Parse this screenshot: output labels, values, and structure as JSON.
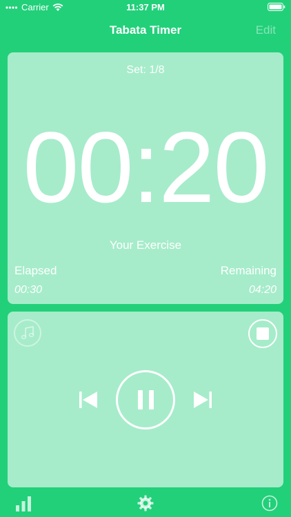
{
  "status_bar": {
    "carrier": "Carrier",
    "time": "11:37 PM"
  },
  "nav": {
    "title": "Tabata Timer",
    "edit_label": "Edit"
  },
  "timer": {
    "set_label": "Set: 1/8",
    "clock": "00:20",
    "exercise": "Your Exercise",
    "elapsed_label": "Elapsed",
    "elapsed_value": "00:30",
    "remaining_label": "Remaining",
    "remaining_value": "04:20"
  },
  "colors": {
    "background": "#22d07a",
    "card": "rgba(255,255,255,0.6)",
    "foreground": "#ffffff"
  },
  "icons": {
    "music": "music-note-icon",
    "stop": "stop-icon",
    "previous": "skip-back-icon",
    "pause": "pause-icon",
    "next": "skip-forward-icon",
    "stats": "bar-chart-icon",
    "settings": "gear-icon",
    "info": "info-icon"
  }
}
